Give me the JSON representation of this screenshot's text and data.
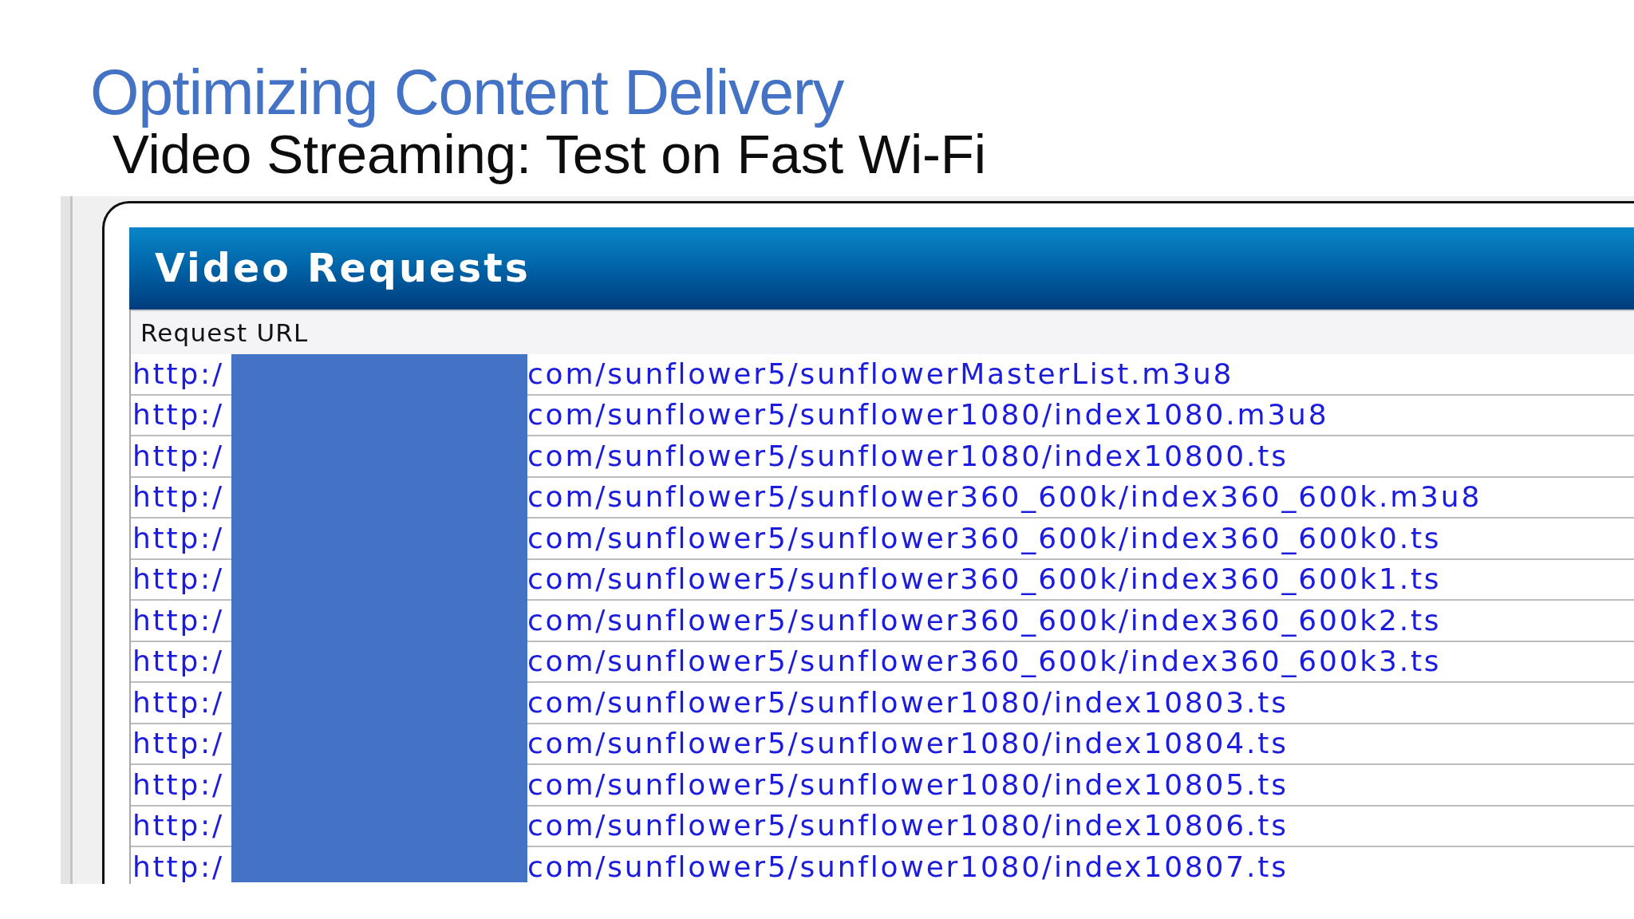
{
  "slide": {
    "title": "Optimizing Content Delivery",
    "subtitle": "Video Streaming: Test on Fast Wi-Fi"
  },
  "panel": {
    "title": "Video Requests",
    "table": {
      "columns": [
        "Request URL"
      ],
      "redacted": true,
      "rows": [
        {
          "url_start": "http:/",
          "url_end": "com/sunflower5/sunflowerMasterList.m3u8"
        },
        {
          "url_start": "http:/",
          "url_end": "com/sunflower5/sunflower1080/index1080.m3u8"
        },
        {
          "url_start": "http:/",
          "url_end": "com/sunflower5/sunflower1080/index10800.ts"
        },
        {
          "url_start": "http:/",
          "url_end": "com/sunflower5/sunflower360_600k/index360_600k.m3u8"
        },
        {
          "url_start": "http:/",
          "url_end": "com/sunflower5/sunflower360_600k/index360_600k0.ts"
        },
        {
          "url_start": "http:/",
          "url_end": "com/sunflower5/sunflower360_600k/index360_600k1.ts"
        },
        {
          "url_start": "http:/",
          "url_end": "com/sunflower5/sunflower360_600k/index360_600k2.ts"
        },
        {
          "url_start": "http:/",
          "url_end": "com/sunflower5/sunflower360_600k/index360_600k3.ts"
        },
        {
          "url_start": "http:/",
          "url_end": "com/sunflower5/sunflower1080/index10803.ts"
        },
        {
          "url_start": "http:/",
          "url_end": "com/sunflower5/sunflower1080/index10804.ts"
        },
        {
          "url_start": "http:/",
          "url_end": "com/sunflower5/sunflower1080/index10805.ts"
        },
        {
          "url_start": "http:/",
          "url_end": "com/sunflower5/sunflower1080/index10806.ts"
        },
        {
          "url_start": "http:/",
          "url_end": "com/sunflower5/sunflower1080/index10807.ts"
        }
      ]
    }
  }
}
